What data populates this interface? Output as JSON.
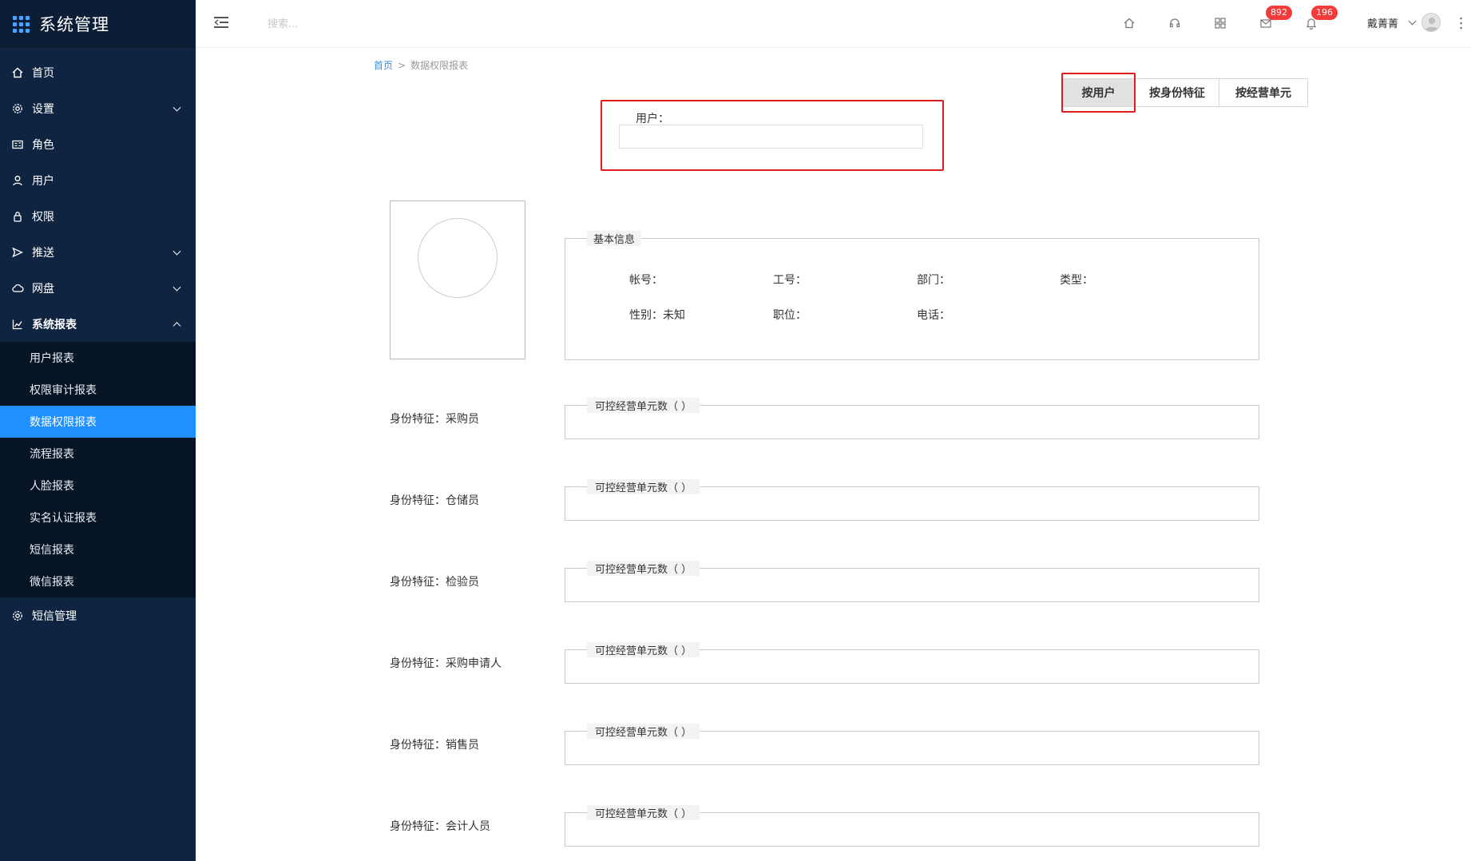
{
  "sidebar": {
    "title": "系统管理",
    "menu": [
      {
        "label": "首页",
        "icon": "home-icon"
      },
      {
        "label": "设置",
        "icon": "gear-icon",
        "expandable": true
      },
      {
        "label": "角色",
        "icon": "id-card-icon"
      },
      {
        "label": "用户",
        "icon": "user-icon"
      },
      {
        "label": "权限",
        "icon": "lock-icon"
      },
      {
        "label": "推送",
        "icon": "send-icon",
        "expandable": true
      },
      {
        "label": "网盘",
        "icon": "cloud-icon",
        "expandable": true
      },
      {
        "label": "系统报表",
        "icon": "chart-line-icon",
        "expandable": true,
        "expanded": true
      }
    ],
    "submenu": [
      {
        "label": "用户报表"
      },
      {
        "label": "权限审计报表"
      },
      {
        "label": "数据权限报表",
        "active": true
      },
      {
        "label": "流程报表"
      },
      {
        "label": "人脸报表"
      },
      {
        "label": "实名认证报表"
      },
      {
        "label": "短信报表"
      },
      {
        "label": "微信报表"
      }
    ],
    "bottom_menu": [
      {
        "label": "短信管理",
        "icon": "gear-icon"
      }
    ],
    "colors": {
      "bg": "#0f2440",
      "active": "#1e90ff"
    }
  },
  "header": {
    "search_placeholder": "搜索...",
    "icons": [
      "home-icon",
      "headset-icon",
      "apps-icon",
      "mail-icon",
      "bell-icon"
    ],
    "mail_badge": "892",
    "bell_badge": "196",
    "username": "戴菁菁"
  },
  "breadcrumb": {
    "home": "首页",
    "separator": ">",
    "current": "数据权限报表"
  },
  "tabs": {
    "by_user": "按用户",
    "by_identity": "按身份特征",
    "by_unit": "按经营单元",
    "active": "by_user"
  },
  "user_search": {
    "label": "用户：",
    "value": ""
  },
  "basic_info": {
    "legend": "基本信息",
    "row1": [
      "帐号：",
      "工号：",
      "部门：",
      "类型："
    ],
    "row2": [
      "性别：未知",
      "职位：",
      "电话："
    ]
  },
  "features": [
    {
      "label": "身份特征：采购员",
      "legend": "可控经营单元数（ ）"
    },
    {
      "label": "身份特征：仓储员",
      "legend": "可控经营单元数（ ）"
    },
    {
      "label": "身份特征：检验员",
      "legend": "可控经营单元数（ ）"
    },
    {
      "label": "身份特征：采购申请人",
      "legend": "可控经营单元数（ ）"
    },
    {
      "label": "身份特征：销售员",
      "legend": "可控经营单元数（ ）"
    },
    {
      "label": "身份特征：会计人员",
      "legend": "可控经营单元数（ ）"
    }
  ]
}
